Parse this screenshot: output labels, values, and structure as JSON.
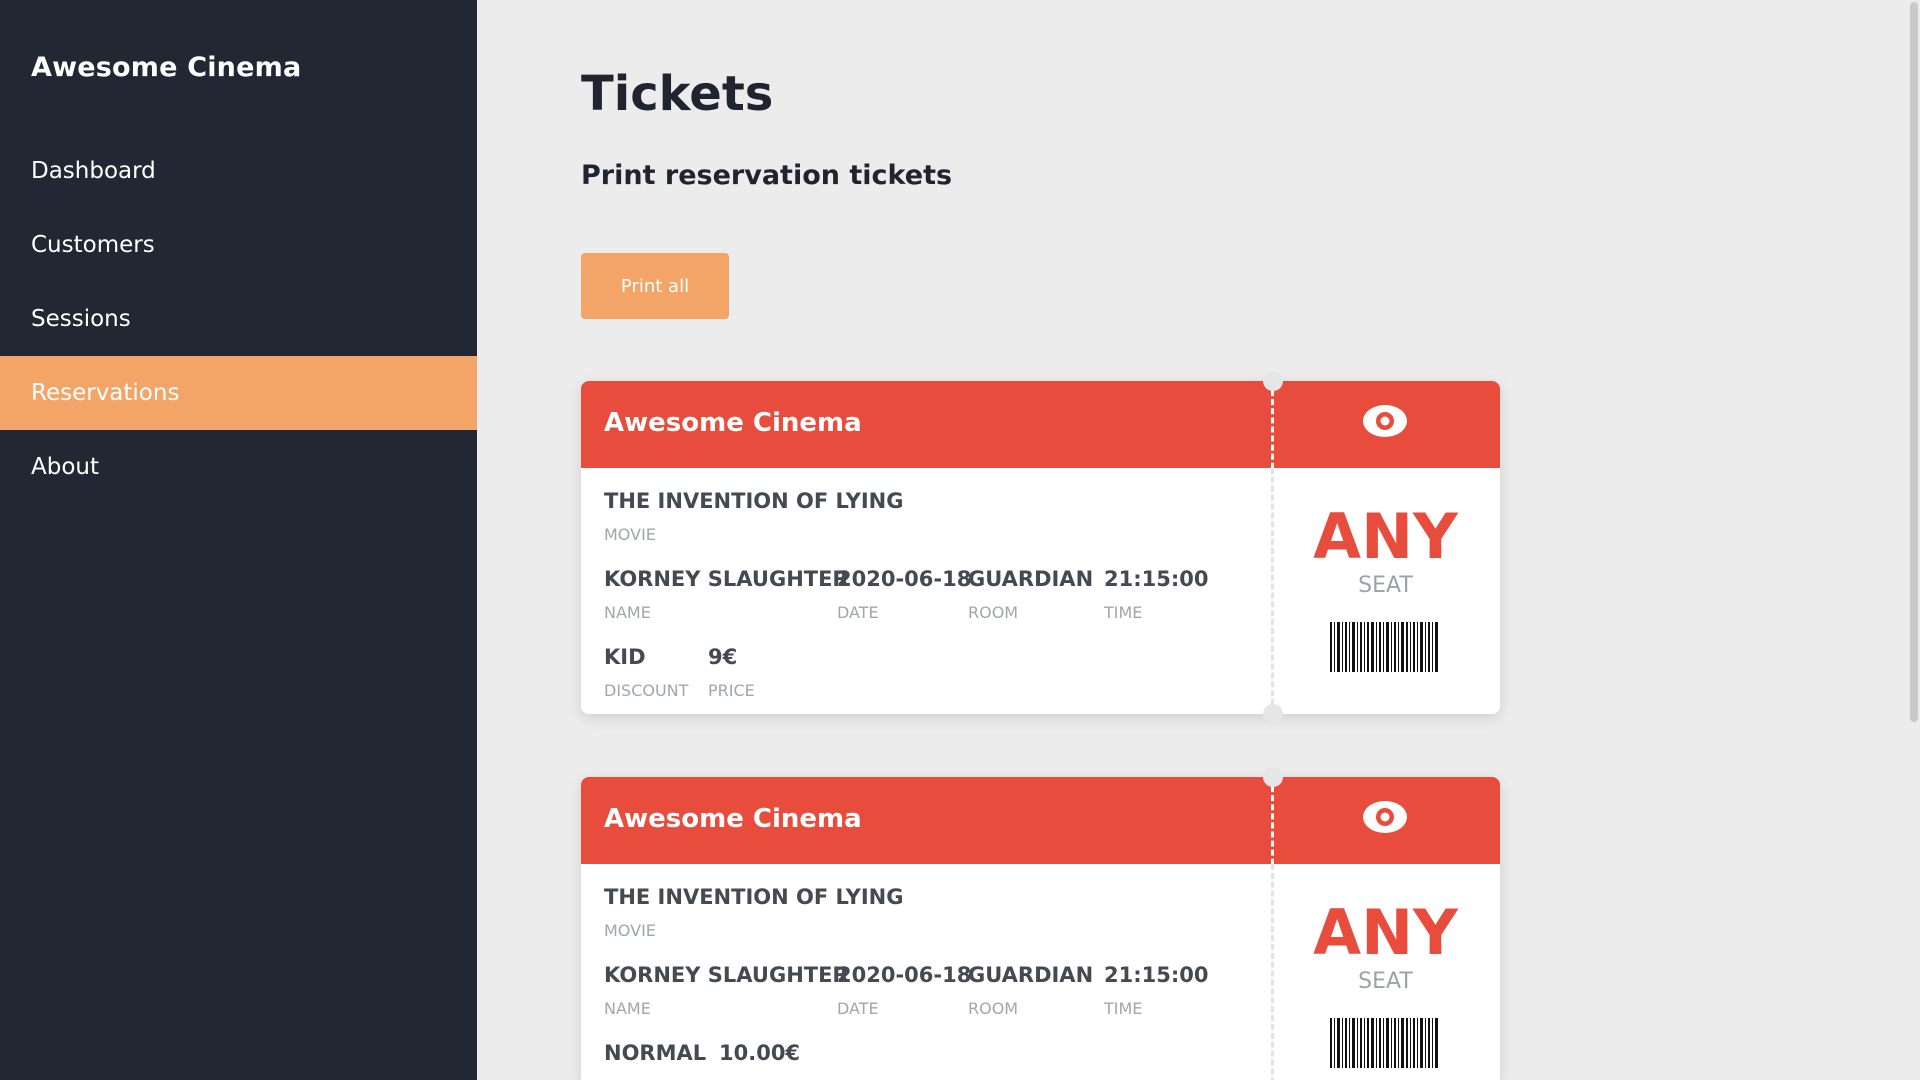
{
  "sidebar": {
    "brand": "Awesome Cinema",
    "items": [
      {
        "label": "Dashboard"
      },
      {
        "label": "Customers"
      },
      {
        "label": "Sessions"
      },
      {
        "label": "Reservations"
      },
      {
        "label": "About"
      }
    ],
    "active_item": "Reservations"
  },
  "main": {
    "title": "Tickets",
    "subtitle": "Print reservation tickets",
    "print_button": "Print all"
  },
  "tickets": [
    {
      "cinema": "Awesome Cinema",
      "movie": "THE INVENTION OF LYING",
      "movie_label": "MOVIE",
      "name": "KORNEY SLAUGHTER",
      "name_label": "NAME",
      "date": "2020-06-18",
      "date_label": "DATE",
      "room": "GUARDIAN",
      "room_label": "ROOM",
      "time": "21:15:00",
      "time_label": "TIME",
      "discount": "KID",
      "discount_label": "DISCOUNT",
      "price": "9€",
      "price_label": "PRICE",
      "seat": "ANY",
      "seat_label": "SEAT",
      "icon": "eye-icon"
    },
    {
      "cinema": "Awesome Cinema",
      "movie": "THE INVENTION OF LYING",
      "movie_label": "MOVIE",
      "name": "KORNEY SLAUGHTER",
      "name_label": "NAME",
      "date": "2020-06-18",
      "date_label": "DATE",
      "room": "GUARDIAN",
      "room_label": "ROOM",
      "time": "21:15:00",
      "time_label": "TIME",
      "discount": "NORMAL",
      "price": "10.00€",
      "seat": "ANY",
      "seat_label": "SEAT",
      "icon": "eye-icon"
    }
  ],
  "colors": {
    "sidebar_bg": "#222833",
    "accent": "#f2a566",
    "ticket_red": "#e74c3c",
    "page_bg": "#ececec"
  }
}
